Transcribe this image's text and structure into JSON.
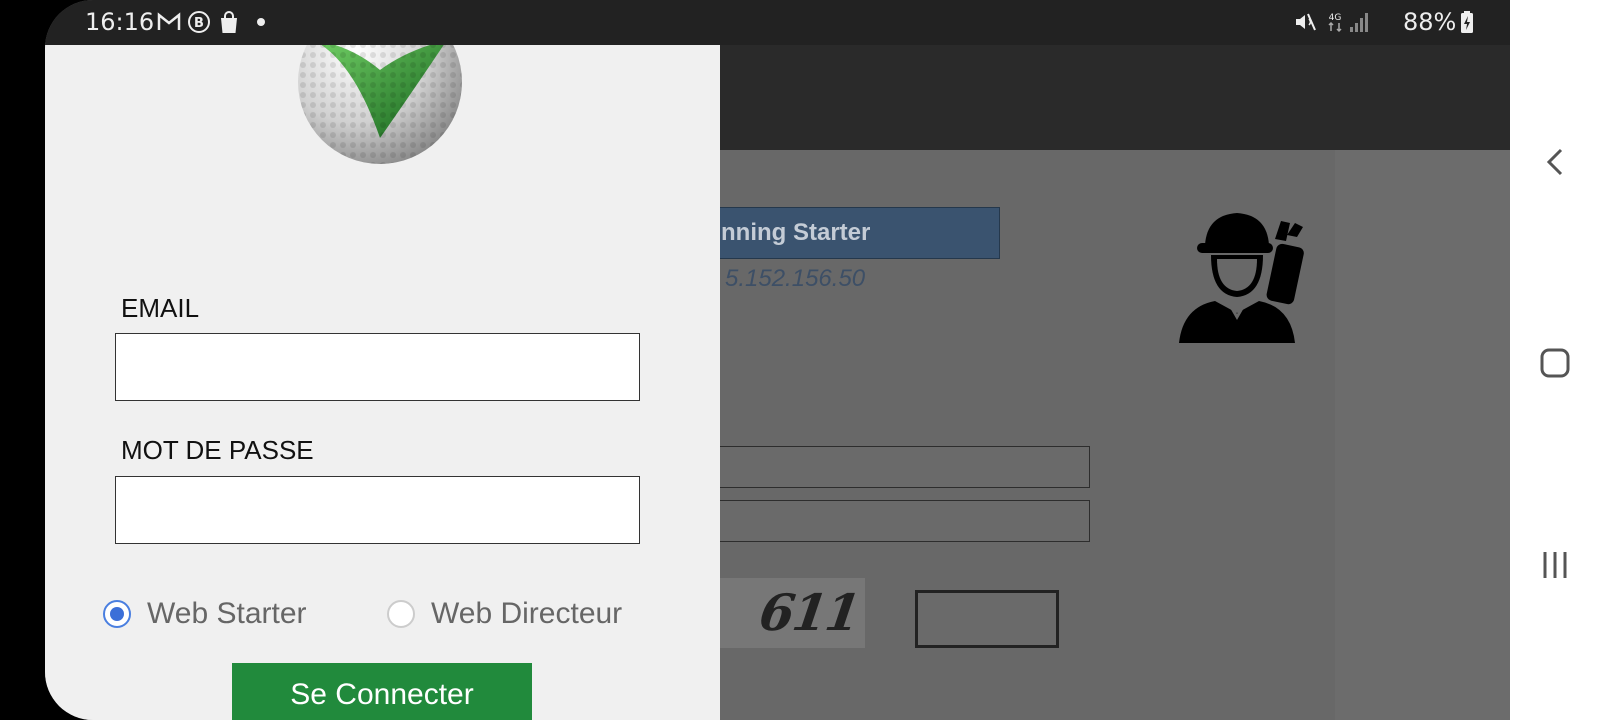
{
  "status_bar": {
    "time": "16:16",
    "notification_icons": [
      "gmail-icon",
      "b-badge-icon",
      "shopping-bag-icon",
      "dot-icon"
    ],
    "system_icons": [
      "mute-icon",
      "4g-icon",
      "signal-icon"
    ],
    "battery": "88%"
  },
  "background_app": {
    "button_label": "nning Starter",
    "server_ip": "5.152.156.50",
    "captcha_text": "611",
    "icon": "golfer-icon"
  },
  "drawer": {
    "logo": "golf-ball-logo",
    "email_label": "EMAIL",
    "email_value": "",
    "password_label": "MOT DE PASSE",
    "password_value": "",
    "radio_options": [
      {
        "label": "Web Starter",
        "checked": true
      },
      {
        "label": "Web Directeur",
        "checked": false
      }
    ],
    "connect_button": "Se Connecter",
    "accent_color": "#218a3c",
    "radio_color": "#3b6fd8"
  },
  "nav_bar": {
    "buttons": [
      "back-icon",
      "home-icon",
      "recents-icon"
    ]
  }
}
